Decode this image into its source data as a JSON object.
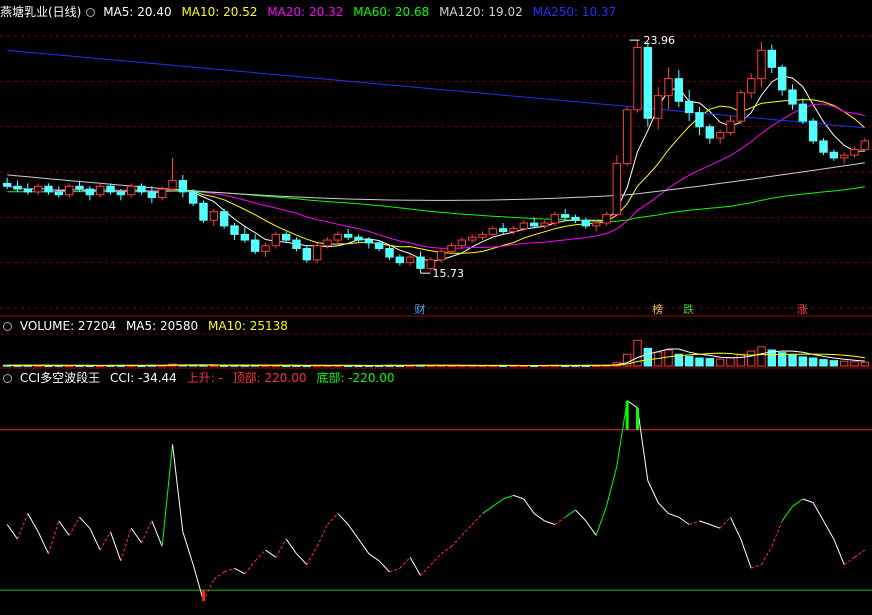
{
  "price_panel": {
    "stock_name": "燕塘乳业(日线)",
    "indicators": [
      {
        "label": "MA5: 20.40",
        "color": "#ffffff"
      },
      {
        "label": "MA10: 20.52",
        "color": "#ffff00"
      },
      {
        "label": "MA20: 20.32",
        "color": "#ff00ff"
      },
      {
        "label": "MA60: 20.68",
        "color": "#00ff00"
      },
      {
        "label": "MA120: 19.02",
        "color": "#cfcfcf"
      },
      {
        "label": "MA250: 10.37",
        "color": "#2030ff"
      }
    ],
    "high_label": "23.96",
    "low_label": "15.73",
    "event_markers": [
      {
        "text": "财",
        "color": "#3fa9ff"
      },
      {
        "text": "榜",
        "color": "#f2c44a"
      },
      {
        "text": "跌",
        "color": "#3fcf3f"
      },
      {
        "text": "涨",
        "color": "#ff4040"
      }
    ]
  },
  "volume_panel": {
    "indicators": [
      {
        "label": "VOLUME: 27204",
        "color": "#ffffff"
      },
      {
        "label": "MA5: 20580",
        "color": "#ffffff"
      },
      {
        "label": "MA10: 25138",
        "color": "#ffff00"
      }
    ]
  },
  "cci_panel": {
    "indicators": [
      {
        "label": "CCI多空波段王",
        "color": "#ffffff"
      },
      {
        "label": "CCI: -34.44",
        "color": "#ffffff"
      },
      {
        "label": "上升: -",
        "color": "#ff3030"
      },
      {
        "label": "顶部: 220.00",
        "color": "#ff3030"
      },
      {
        "label": "底部: -220.00",
        "color": "#00ff00"
      }
    ]
  },
  "chart_data": [
    {
      "type": "candlestick",
      "title": "燕塘乳业(日线)",
      "ylim": [
        14.5,
        24.6
      ],
      "high_mark": 23.96,
      "low_mark": 15.73,
      "ohlc": [
        [
          18.9,
          19.1,
          18.7,
          18.8
        ],
        [
          18.8,
          19.0,
          18.6,
          18.7
        ],
        [
          18.7,
          18.9,
          18.5,
          18.6
        ],
        [
          18.6,
          18.9,
          18.5,
          18.8
        ],
        [
          18.8,
          18.9,
          18.5,
          18.6
        ],
        [
          18.6,
          18.8,
          18.4,
          18.5
        ],
        [
          18.5,
          18.9,
          18.4,
          18.8
        ],
        [
          18.8,
          19.0,
          18.6,
          18.7
        ],
        [
          18.7,
          18.8,
          18.3,
          18.5
        ],
        [
          18.5,
          18.9,
          18.4,
          18.8
        ],
        [
          18.8,
          18.9,
          18.5,
          18.6
        ],
        [
          18.6,
          18.7,
          18.3,
          18.5
        ],
        [
          18.5,
          18.9,
          18.4,
          18.8
        ],
        [
          18.8,
          18.9,
          18.5,
          18.6
        ],
        [
          18.6,
          18.8,
          18.2,
          18.4
        ],
        [
          18.4,
          18.8,
          18.3,
          18.7
        ],
        [
          18.7,
          19.8,
          18.6,
          19.0
        ],
        [
          19.0,
          19.2,
          18.4,
          18.6
        ],
        [
          18.6,
          18.7,
          18.1,
          18.2
        ],
        [
          18.2,
          18.3,
          17.5,
          17.6
        ],
        [
          17.6,
          18.0,
          17.4,
          17.9
        ],
        [
          17.9,
          18.0,
          17.3,
          17.4
        ],
        [
          17.4,
          17.5,
          16.9,
          17.1
        ],
        [
          17.1,
          17.4,
          16.8,
          16.9
        ],
        [
          16.9,
          17.1,
          16.4,
          16.5
        ],
        [
          16.5,
          16.8,
          16.3,
          16.7
        ],
        [
          16.7,
          17.2,
          16.6,
          17.1
        ],
        [
          17.1,
          17.2,
          16.8,
          16.9
        ],
        [
          16.9,
          17.0,
          16.5,
          16.6
        ],
        [
          16.6,
          16.7,
          16.1,
          16.2
        ],
        [
          16.2,
          16.8,
          16.1,
          16.7
        ],
        [
          16.7,
          17.0,
          16.6,
          16.9
        ],
        [
          16.9,
          17.2,
          16.8,
          17.1
        ],
        [
          17.1,
          17.3,
          16.9,
          17.0
        ],
        [
          17.0,
          17.1,
          16.8,
          16.9
        ],
        [
          16.9,
          17.0,
          16.6,
          16.8
        ],
        [
          16.8,
          16.9,
          16.5,
          16.6
        ],
        [
          16.6,
          16.7,
          16.2,
          16.3
        ],
        [
          16.3,
          16.4,
          16.0,
          16.1
        ],
        [
          16.1,
          16.4,
          16.0,
          16.3
        ],
        [
          16.3,
          16.5,
          15.73,
          15.9
        ],
        [
          15.9,
          16.3,
          15.8,
          16.2
        ],
        [
          16.2,
          16.6,
          16.1,
          16.5
        ],
        [
          16.5,
          16.8,
          16.4,
          16.7
        ],
        [
          16.7,
          17.0,
          16.6,
          16.9
        ],
        [
          16.9,
          17.1,
          16.8,
          17.0
        ],
        [
          17.0,
          17.2,
          16.9,
          17.1
        ],
        [
          17.1,
          17.4,
          17.0,
          17.3
        ],
        [
          17.3,
          17.5,
          17.1,
          17.2
        ],
        [
          17.2,
          17.4,
          17.1,
          17.3
        ],
        [
          17.3,
          17.6,
          17.2,
          17.5
        ],
        [
          17.5,
          17.7,
          17.3,
          17.4
        ],
        [
          17.4,
          17.6,
          17.3,
          17.5
        ],
        [
          17.5,
          17.9,
          17.4,
          17.8
        ],
        [
          17.8,
          18.0,
          17.6,
          17.7
        ],
        [
          17.7,
          17.8,
          17.5,
          17.6
        ],
        [
          17.6,
          17.7,
          17.3,
          17.4
        ],
        [
          17.4,
          17.6,
          17.2,
          17.5
        ],
        [
          17.5,
          17.9,
          17.4,
          17.8
        ],
        [
          17.8,
          19.9,
          17.8,
          19.6
        ],
        [
          19.6,
          21.6,
          19.5,
          21.5
        ],
        [
          21.5,
          23.96,
          21.4,
          23.7
        ],
        [
          23.7,
          23.9,
          20.9,
          21.2
        ],
        [
          21.2,
          22.3,
          20.8,
          22.0
        ],
        [
          22.0,
          23.0,
          21.5,
          22.6
        ],
        [
          22.6,
          22.9,
          21.6,
          21.8
        ],
        [
          21.8,
          22.2,
          21.1,
          21.4
        ],
        [
          21.4,
          21.6,
          20.6,
          20.9
        ],
        [
          20.9,
          21.0,
          20.3,
          20.5
        ],
        [
          20.5,
          20.8,
          20.3,
          20.7
        ],
        [
          20.7,
          21.3,
          20.6,
          21.1
        ],
        [
          21.1,
          22.2,
          21.0,
          22.1
        ],
        [
          22.1,
          22.8,
          21.9,
          22.6
        ],
        [
          22.6,
          23.9,
          22.3,
          23.6
        ],
        [
          23.6,
          23.8,
          22.8,
          23.0
        ],
        [
          23.0,
          23.1,
          22.0,
          22.2
        ],
        [
          22.2,
          22.4,
          21.5,
          21.7
        ],
        [
          21.7,
          21.9,
          21.0,
          21.1
        ],
        [
          21.1,
          21.2,
          20.3,
          20.4
        ],
        [
          20.4,
          20.5,
          19.9,
          20.0
        ],
        [
          20.0,
          20.1,
          19.7,
          19.8
        ],
        [
          19.8,
          20.0,
          19.6,
          19.9
        ],
        [
          19.9,
          20.2,
          19.8,
          20.1
        ],
        [
          20.1,
          20.5,
          20.0,
          20.4
        ]
      ],
      "series": [
        {
          "name": "MA5",
          "color": "#ffffff"
        },
        {
          "name": "MA10",
          "color": "#ffff00"
        },
        {
          "name": "MA20",
          "color": "#ff00ff"
        },
        {
          "name": "MA60",
          "color": "#00ff00"
        },
        {
          "name": "MA120",
          "color": "#cfcfcf"
        },
        {
          "name": "MA250",
          "color": "#2030ff"
        }
      ]
    },
    {
      "type": "bar",
      "title": "VOLUME",
      "ylim": [
        0,
        60000
      ],
      "values": [
        1500,
        1200,
        1300,
        1100,
        1000,
        1200,
        900,
        1100,
        1000,
        900,
        1200,
        1100,
        1300,
        1000,
        1400,
        1200,
        3500,
        2000,
        1800,
        1500,
        1300,
        1200,
        1400,
        1300,
        1500,
        1200,
        1100,
        1000,
        1100,
        900,
        1200,
        1000,
        1100,
        1000,
        900,
        1000,
        1100,
        1200,
        1000,
        1300,
        1500,
        1200,
        1100,
        1000,
        1100,
        1000,
        900,
        1000,
        1100,
        1000,
        900,
        1000,
        1100,
        1200,
        1000,
        1100,
        1000,
        1200,
        1500,
        6000,
        22000,
        48000,
        33000,
        26000,
        30000,
        22000,
        18000,
        15000,
        14000,
        13000,
        16000,
        22000,
        28000,
        36000,
        30000,
        25000,
        21000,
        17000,
        15000,
        12000,
        10000,
        9000,
        8000,
        7000
      ]
    },
    {
      "type": "line",
      "title": "CCI",
      "ylim": [
        -280,
        340
      ],
      "reference_lines": [
        220,
        -220
      ],
      "values": [
        -40,
        -80,
        -10,
        -60,
        -120,
        -30,
        -70,
        -20,
        -50,
        -110,
        -60,
        -140,
        -50,
        -90,
        -30,
        -100,
        180,
        -60,
        -150,
        -250,
        -190,
        -170,
        -160,
        -175,
        -140,
        -110,
        -130,
        -80,
        -120,
        -150,
        -100,
        -40,
        -10,
        -40,
        -80,
        -120,
        -140,
        -170,
        -160,
        -130,
        -180,
        -150,
        -120,
        -100,
        -70,
        -40,
        -10,
        10,
        30,
        40,
        30,
        -10,
        -30,
        -40,
        -20,
        0,
        -30,
        -70,
        10,
        120,
        300,
        280,
        80,
        20,
        -10,
        -20,
        -40,
        -30,
        -40,
        -50,
        -20,
        -80,
        -160,
        -150,
        -100,
        -30,
        10,
        30,
        20,
        -30,
        -80,
        -150,
        -130,
        -110
      ]
    }
  ]
}
